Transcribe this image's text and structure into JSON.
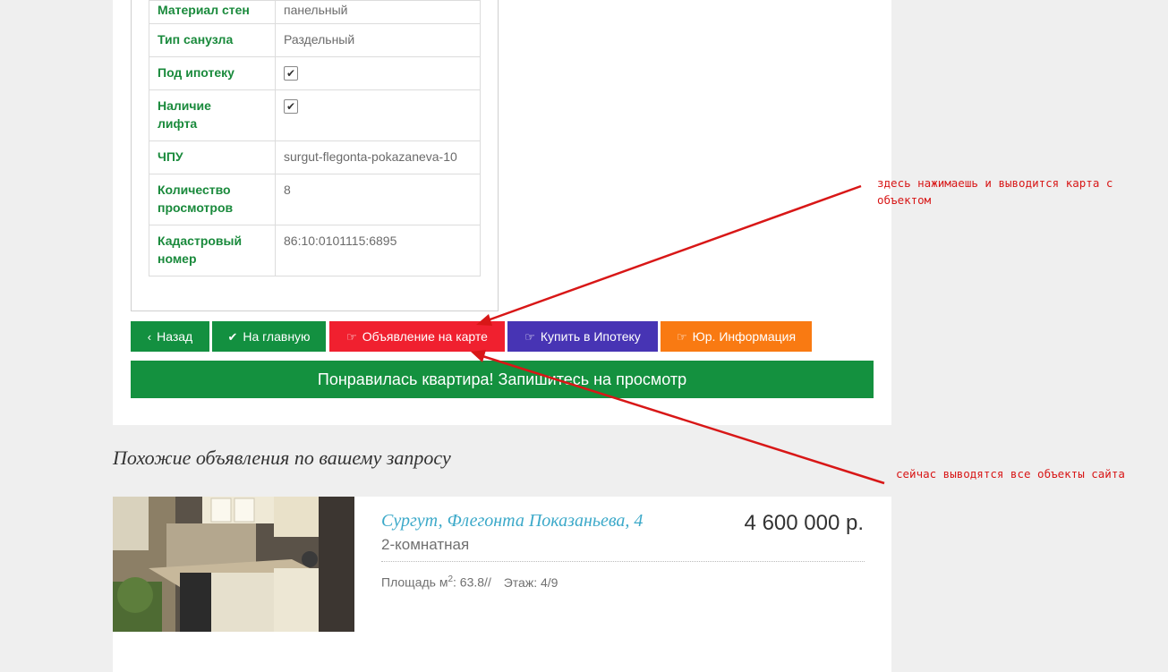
{
  "properties": [
    {
      "label": "Материал стен",
      "value": "панельный"
    },
    {
      "label": "Тип санузла",
      "value": "Раздельный"
    },
    {
      "label": "Под ипотеку",
      "value": "✔",
      "checkbox": true
    },
    {
      "label": "Наличие лифта",
      "value": "✔",
      "checkbox": true
    },
    {
      "label": "ЧПУ",
      "value": "surgut-flegonta-pokazaneva-10"
    },
    {
      "label": "Количество просмотров",
      "value": "8"
    },
    {
      "label": "Кадастровый номер",
      "value": "86:10:0101115:6895"
    }
  ],
  "buttons": {
    "back": {
      "icon": "‹",
      "label": "Назад",
      "color": "#139040"
    },
    "home": {
      "icon": "✔",
      "label": "На главную",
      "color": "#139040"
    },
    "map": {
      "icon": "☞",
      "label": "Объявление на карте",
      "color": "#f0202f"
    },
    "mortgage": {
      "icon": "☞",
      "label": "Купить в Ипотеку",
      "color": "#4734b4"
    },
    "legal": {
      "icon": "☞",
      "label": "Юр. Информация",
      "color": "#f97a12"
    }
  },
  "cta": {
    "label": "Понравилась квартира! Запишитесь на просмотр",
    "color": "#14913f"
  },
  "similar": {
    "title": "Похожие объявления по вашему запросу",
    "listing": {
      "address": "Сургут, Флегонта Показаньева, 4",
      "rooms": "2-комнатная",
      "price": "4 600 000 р.",
      "area_label": "Площадь м",
      "area_sup": "2",
      "area_value": ": 63.8//",
      "floor": "Этаж: 4/9"
    }
  },
  "annotations": {
    "note1": "здесь нажимаешь и выводится карта с объектом",
    "note2": "сейчас выводятся все объекты сайта",
    "color": "#d81717"
  }
}
